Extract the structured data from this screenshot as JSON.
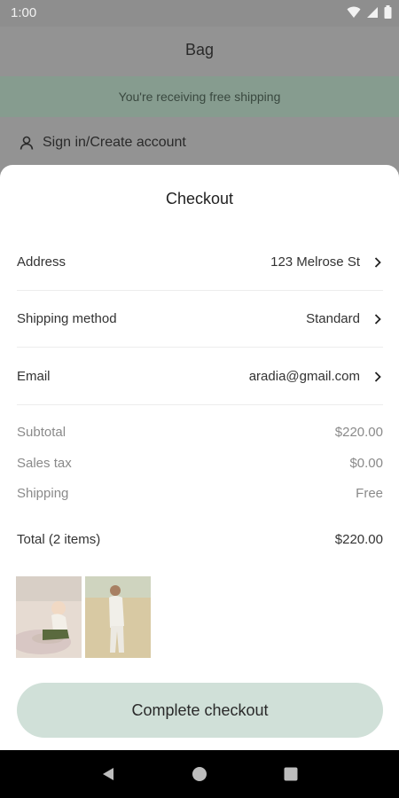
{
  "status_bar": {
    "time": "1:00"
  },
  "background_page": {
    "title": "Bag",
    "banner": "You're receiving free shipping",
    "signin": "Sign in/Create account"
  },
  "sheet": {
    "title": "Checkout",
    "rows": [
      {
        "label": "Address",
        "value": "123 Melrose St"
      },
      {
        "label": "Shipping method",
        "value": "Standard"
      },
      {
        "label": "Email",
        "value": "aradia@gmail.com"
      }
    ],
    "summary": [
      {
        "label": "Subtotal",
        "value": "$220.00"
      },
      {
        "label": "Sales tax",
        "value": "$0.00"
      },
      {
        "label": "Shipping",
        "value": "Free"
      }
    ],
    "total": {
      "label": "Total (2 items)",
      "value": "$220.00"
    },
    "items": [
      "product-thumbnail-baby",
      "product-thumbnail-woman"
    ],
    "cta": "Complete checkout"
  },
  "colors": {
    "accent_button": "#d0e0d8",
    "banner": "#869c8f"
  }
}
